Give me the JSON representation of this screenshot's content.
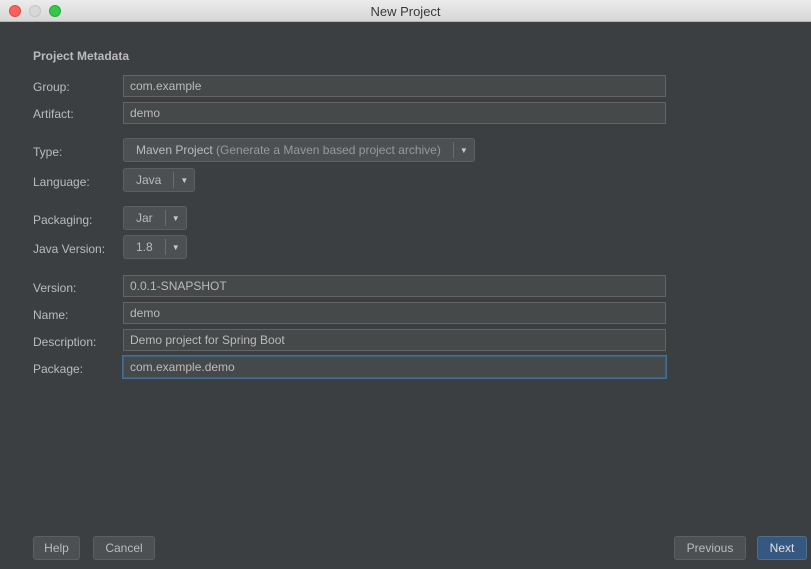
{
  "window": {
    "title": "New Project"
  },
  "section_title": "Project Metadata",
  "fields": {
    "group": {
      "label": "Group:",
      "value": "com.example"
    },
    "artifact": {
      "label": "Artifact:",
      "value": "demo"
    },
    "version": {
      "label": "Version:",
      "value": "0.0.1-SNAPSHOT"
    },
    "name": {
      "label": "Name:",
      "value": "demo"
    },
    "description": {
      "label": "Description:",
      "value": "Demo project for Spring Boot"
    },
    "package": {
      "label": "Package:",
      "value": "com.example.demo"
    }
  },
  "selects": {
    "type": {
      "label": "Type:",
      "value": "Maven Project",
      "hint": "(Generate a Maven based project archive)"
    },
    "language": {
      "label": "Language:",
      "value": "Java"
    },
    "packaging": {
      "label": "Packaging:",
      "value": "Jar"
    },
    "java_version": {
      "label": "Java Version:",
      "value": "1.8"
    }
  },
  "buttons": {
    "help": "Help",
    "cancel": "Cancel",
    "previous": "Previous",
    "next": "Next"
  },
  "colors": {
    "background": "#3c3f41",
    "field_background": "#45494a",
    "focus_border": "#466d94",
    "primary_button": "#365880",
    "text": "#bbbbbb"
  },
  "icons": {
    "dropdown": "chevron-down-icon",
    "close": "close-icon",
    "minimize": "minimize-icon",
    "maximize": "maximize-icon"
  }
}
